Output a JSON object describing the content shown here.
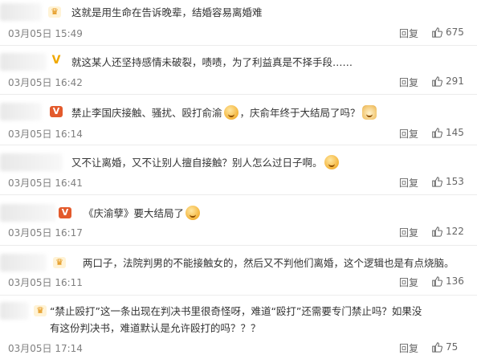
{
  "comments": [
    {
      "text_parts": [
        "这就是用生命在告诉晚辈，结婚容易离婚难"
      ],
      "date": "03月05日 15:49",
      "reply_label": "回复",
      "likes": "675",
      "badge": "crown"
    },
    {
      "text_parts": [
        "就这某人还坚持感情未破裂，啧啧，为了利益真是不择手段……"
      ],
      "date": "03月05日 16:42",
      "reply_label": "回复",
      "likes": "291",
      "badge": "vip-y"
    },
    {
      "text_parts": [
        "禁止李国庆接触、骚扰、殴打俞渝",
        "，庆俞年终于大结局了吗？"
      ],
      "date": "03月05日 16:14",
      "reply_label": "回复",
      "likes": "145",
      "badge": "vip-r"
    },
    {
      "text_parts": [
        "又不让离婚，又不让别人擅自接触？别人怎么过日子啊。"
      ],
      "date": "03月05日 16:41",
      "reply_label": "回复",
      "likes": "153",
      "badge": "none"
    },
    {
      "text_parts": [
        "《庆渝孽》要大结局了"
      ],
      "date": "03月05日 16:17",
      "reply_label": "回复",
      "likes": "122",
      "badge": "vip-r"
    },
    {
      "text_parts": [
        "两口子，法院判男的不能接触女的，然后又不判他们离婚，这个逻辑也是有点烧脑。"
      ],
      "date": "03月05日 16:11",
      "reply_label": "回复",
      "likes": "136",
      "badge": "crown"
    },
    {
      "text_parts": [
        "“禁止殴打”这一条出现在判决书里很奇怪呀，难道“殴打”还需要专门禁止吗？如果没有这份判决书，难道默认是允许殴打的吗？？？"
      ],
      "date": "03月05日 17:14",
      "reply_label": "回复",
      "likes": "75",
      "badge": "crown"
    }
  ],
  "colors": {
    "text": "#333333",
    "meta": "#808080",
    "divider": "#ececec",
    "badge_red": "#e35a2c",
    "badge_gold": "#f0a800"
  }
}
